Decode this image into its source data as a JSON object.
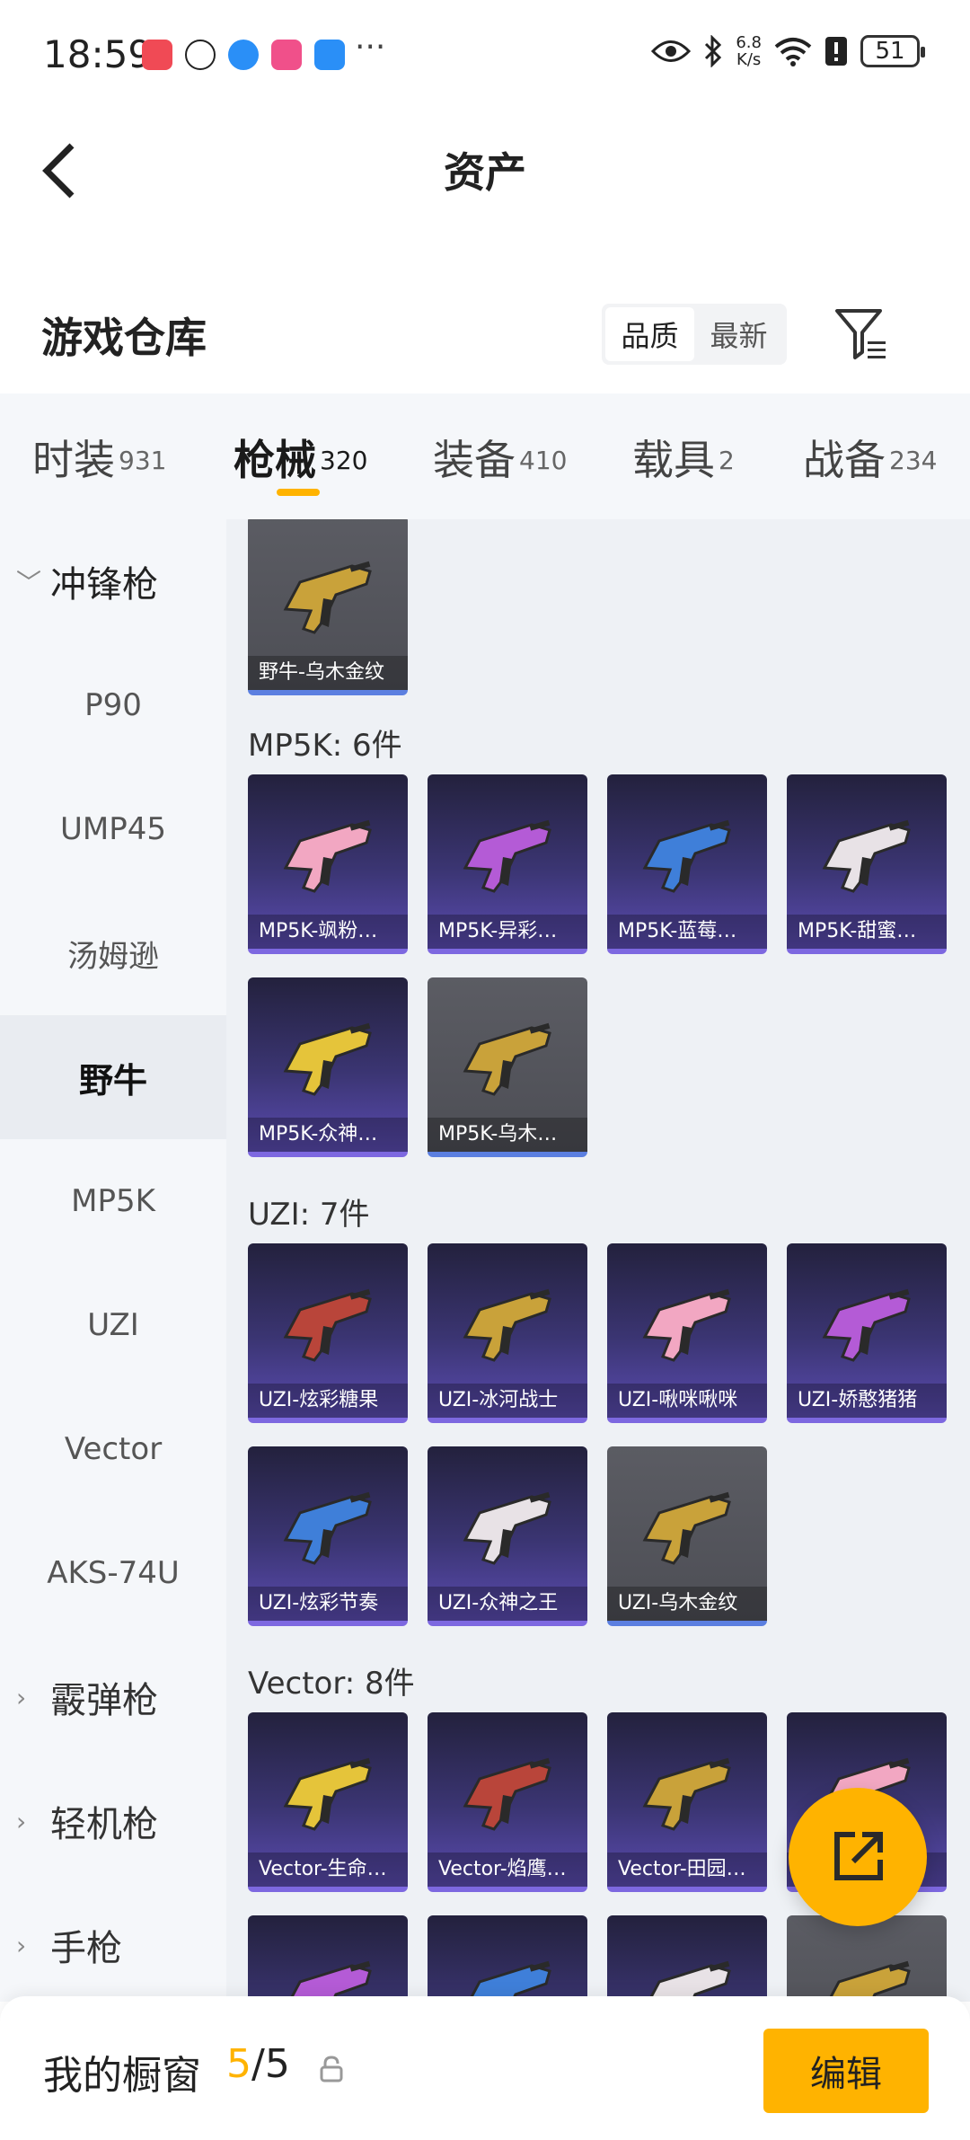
{
  "status_bar": {
    "time": "18:59",
    "more": "···",
    "net_speed_value": "6.8",
    "net_speed_unit": "K/s",
    "battery": "51",
    "app_colors": [
      "#f04a55",
      "#ffc400",
      "#2a8ff7",
      "#f0508a",
      "#2a8ff7"
    ]
  },
  "header": {
    "title": "资产"
  },
  "warehouse": {
    "title": "游戏仓库",
    "sort_options": [
      "品质",
      "最新"
    ],
    "active_sort": "品质"
  },
  "tabs": [
    {
      "name": "时装",
      "count": "931"
    },
    {
      "name": "枪械",
      "count": "320",
      "active": true
    },
    {
      "name": "装备",
      "count": "410"
    },
    {
      "name": "载具",
      "count": "2"
    },
    {
      "name": "战备",
      "count": "234"
    }
  ],
  "sidebar": {
    "group_open": "冲锋枪",
    "items": [
      "P90",
      "UMP45",
      "汤姆逊",
      "野牛",
      "MP5K",
      "UZI",
      "Vector",
      "AKS-74U"
    ],
    "active_item": "野牛",
    "groups_closed": [
      "霰弹枪",
      "轻机枪",
      "手枪"
    ]
  },
  "sections": [
    {
      "title": "",
      "items": [
        {
          "label": "野牛-乌木金纹",
          "tier": "gray"
        }
      ]
    },
    {
      "title": "MP5K: 6件",
      "items": [
        {
          "label": "MP5K-飒粉…",
          "tier": "purple"
        },
        {
          "label": "MP5K-异彩…",
          "tier": "purple"
        },
        {
          "label": "MP5K-蓝莓…",
          "tier": "purple"
        },
        {
          "label": "MP5K-甜蜜…",
          "tier": "purple"
        },
        {
          "label": "MP5K-众神…",
          "tier": "purple"
        },
        {
          "label": "MP5K-乌木…",
          "tier": "gray"
        }
      ]
    },
    {
      "title": "UZI: 7件",
      "items": [
        {
          "label": "UZI-炫彩糖果",
          "tier": "purple"
        },
        {
          "label": "UZI-冰河战士",
          "tier": "purple"
        },
        {
          "label": "UZI-啾咪啾咪",
          "tier": "purple"
        },
        {
          "label": "UZI-娇憨猪猪",
          "tier": "purple"
        },
        {
          "label": "UZI-炫彩节奏",
          "tier": "purple"
        },
        {
          "label": "UZI-众神之王",
          "tier": "purple"
        },
        {
          "label": "UZI-乌木金纹",
          "tier": "gray"
        }
      ]
    },
    {
      "title": "Vector: 8件",
      "items": [
        {
          "label": "Vector-生命…",
          "tier": "purple"
        },
        {
          "label": "Vector-焰鹰…",
          "tier": "purple"
        },
        {
          "label": "Vector-田园…",
          "tier": "purple"
        },
        {
          "label": "",
          "tier": "purple"
        },
        {
          "label": "",
          "tier": "purple"
        },
        {
          "label": "",
          "tier": "purple"
        },
        {
          "label": "",
          "tier": "purple"
        },
        {
          "label": "",
          "tier": "gray"
        }
      ]
    }
  ],
  "gun_colors": {
    "gold": "#c9a23a",
    "pink": "#f2a7c2",
    "purple": "#b45bd6",
    "blue": "#3f7fd9",
    "white": "#e8e2e6",
    "yellow": "#e5c43a",
    "red": "#b9453a",
    "dark": "#2a2a2a"
  },
  "bottom_bar": {
    "title": "我的橱窗",
    "current": "5",
    "total": "/5",
    "edit_label": "编辑"
  }
}
